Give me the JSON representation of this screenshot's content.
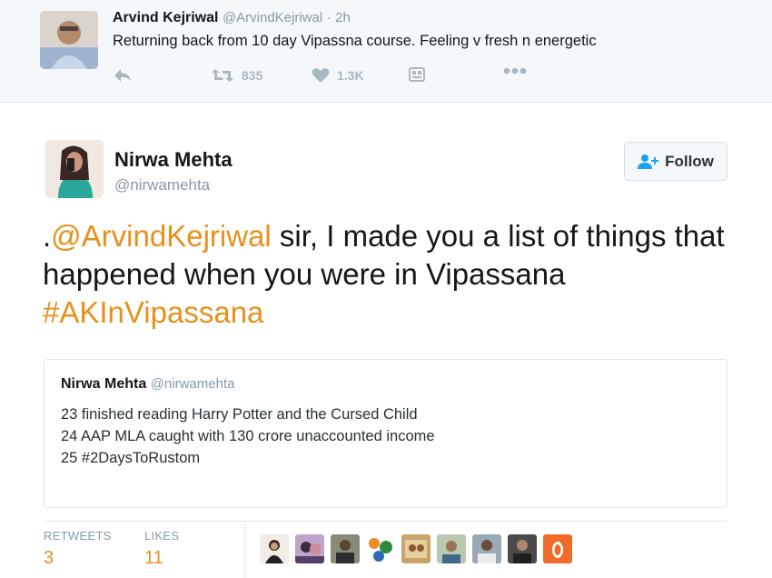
{
  "parent_tweet": {
    "name": "Arvind Kejriwal",
    "handle": "@ArvindKejriwal",
    "separator": "·",
    "time": "2h",
    "text": "Returning back from 10 day Vipassna course. Feeling v fresh n energetic",
    "actions": {
      "reply_icon": "reply-icon",
      "retweet_icon": "retweet-icon",
      "retweet_count": "835",
      "like_icon": "heart-icon",
      "like_count": "1.3K",
      "card_icon": "card-icon",
      "more_icon": "more-dots-icon"
    }
  },
  "tweet": {
    "name": "Nirwa Mehta",
    "handle": "@nirwamehta",
    "follow_label": "Follow",
    "text": {
      "prefix": ".",
      "mention": "@ArvindKejriwal",
      "body": " sir, I made you a list of things that happened when you were in Vipassana ",
      "hashtag": "#AKInVipassana"
    }
  },
  "quoted_tweet": {
    "name": "Nirwa Mehta",
    "handle": "@nirwamehta",
    "lines": [
      "23 finished reading Harry Potter and the Cursed Child",
      "24 AAP MLA caught with 130 crore unaccounted income",
      "25 #2DaysToRustom"
    ]
  },
  "stats": {
    "retweets_label": "RETWEETS",
    "retweets_value": "3",
    "likes_label": "LIKES",
    "likes_value": "11"
  },
  "colors": {
    "accent": "#e8901a",
    "muted": "#8899a6",
    "border": "#e1e8ed",
    "parent_bg": "#f5f8fa"
  }
}
